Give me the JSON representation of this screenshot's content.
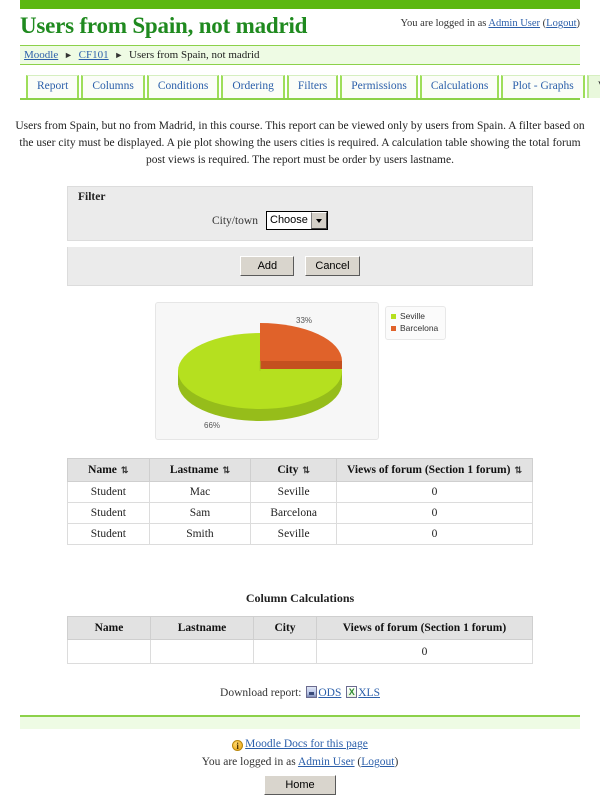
{
  "header": {
    "site_title": "Users from Spain, not madrid",
    "login_prefix": "You are logged in as",
    "login_user": "Admin User",
    "logout_open": "(",
    "logout_label": "Logout",
    "logout_close": ")"
  },
  "breadcrumb": {
    "items": [
      {
        "label": "Moodle",
        "link": true
      },
      {
        "label": "CF101",
        "link": true
      },
      {
        "label": "Users from Spain, not madrid",
        "link": false
      }
    ],
    "separator": "►"
  },
  "tabs": [
    {
      "label": "Report",
      "active": false
    },
    {
      "label": "Columns",
      "active": false
    },
    {
      "label": "Conditions",
      "active": false
    },
    {
      "label": "Ordering",
      "active": false
    },
    {
      "label": "Filters",
      "active": false
    },
    {
      "label": "Permissions",
      "active": false
    },
    {
      "label": "Calculations",
      "active": false
    },
    {
      "label": "Plot - Graphs",
      "active": false
    },
    {
      "label": "View report",
      "active": true
    }
  ],
  "description": "Users from Spain, but no from Madrid, in this course. This report can be viewed only by users from Spain. A filter based on the user city must be displayed. A pie plot showing the users cities is required. A calculation table showing the total forum post views is required. The report must be order by users lastname.",
  "filter": {
    "legend": "Filter",
    "field_label": "City/town",
    "select_value": "Choose",
    "select_options": [
      "Choose"
    ],
    "add_label": "Add",
    "cancel_label": "Cancel"
  },
  "chart_data": {
    "type": "pie",
    "title": "",
    "categories": [
      "Seville",
      "Barcelona"
    ],
    "values": [
      66,
      33
    ],
    "value_labels": [
      "66%",
      "33%"
    ],
    "colors": [
      "#b5e01f",
      "#e0622a"
    ],
    "legend_position": "right",
    "three_d": true
  },
  "report_table": {
    "columns": [
      {
        "label": "Name",
        "sortable": true
      },
      {
        "label": "Lastname",
        "sortable": true
      },
      {
        "label": "City",
        "sortable": true
      },
      {
        "label": "Views of forum (Section 1 forum)",
        "sortable": true
      }
    ],
    "sort_icon": "⇅",
    "rows": [
      [
        "Student",
        "Mac",
        "Seville",
        "0"
      ],
      [
        "Student",
        "Sam",
        "Barcelona",
        "0"
      ],
      [
        "Student",
        "Smith",
        "Seville",
        "0"
      ]
    ]
  },
  "calculations": {
    "title": "Column Calculations",
    "columns": [
      "Name",
      "Lastname",
      "City",
      "Views of forum (Section 1 forum)"
    ],
    "rows": [
      [
        "",
        "",
        "",
        "0"
      ]
    ]
  },
  "download": {
    "label": "Download report:",
    "ods_label": "ODS",
    "xls_label": "XLS"
  },
  "footer": {
    "docs_label": "Moodle Docs for this page",
    "info_glyph": "i",
    "login_prefix": "You are logged in as",
    "login_user": "Admin User",
    "logout_open": "(",
    "logout_label": "Logout",
    "logout_close": ")",
    "home_label": "Home"
  },
  "colors": {
    "brand_green": "#5cb811",
    "title_green": "#1f8a1f",
    "link_blue": "#2b5faa",
    "band_green": "#eefbe4"
  }
}
